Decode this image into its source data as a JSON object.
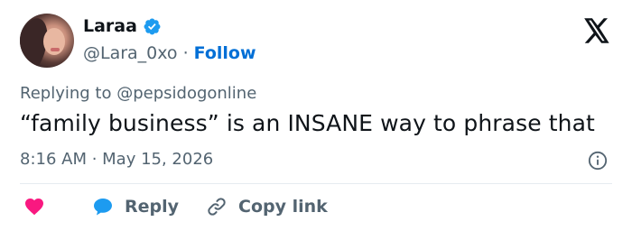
{
  "user": {
    "name": "Laraa",
    "handle": "@Lara_0xo",
    "follow_label": "Follow",
    "separator": "·"
  },
  "tweet": {
    "reply_prefix": "Replying to",
    "reply_to": "@pepsidogonline",
    "text": "“family business” is an INSANE way to phrase that",
    "timestamp": "8:16 AM · May 15, 2026"
  },
  "actions": {
    "reply_label": "Reply",
    "copy_label": "Copy link"
  },
  "colors": {
    "like": "#f91880",
    "reply": "#1d9bf0",
    "link": "#006fd6",
    "verified": "#1d9bf0"
  },
  "icons": {
    "brand": "x-logo-icon",
    "verified": "verified-badge-icon",
    "info": "info-icon",
    "like": "heart-icon",
    "reply": "speech-bubble-icon",
    "copy": "link-icon"
  }
}
